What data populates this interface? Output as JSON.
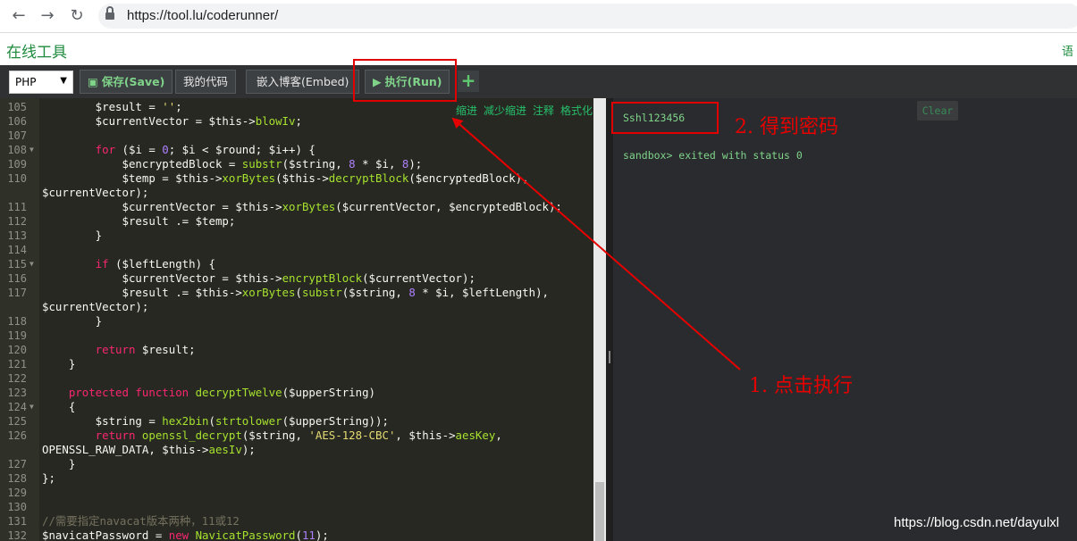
{
  "browser": {
    "back_icon": "arrow-left-icon",
    "forward_icon": "arrow-right-icon",
    "reload_icon": "reload-icon",
    "lock_icon": "lock-icon",
    "url": "https://tool.lu/coderunner/"
  },
  "site": {
    "title": "在线工具",
    "lang_link": "语"
  },
  "toolbar": {
    "language": "PHP",
    "save_label": "保存(Save)",
    "my_code_label": "我的代码",
    "embed_label": "嵌入博客(Embed)",
    "run_label": "执行(Run)",
    "add_label": "+"
  },
  "editor": {
    "links": [
      "缩进",
      "减少缩进",
      "注释",
      "格式化"
    ],
    "lines": [
      {
        "n": "105",
        "fold": false,
        "code": [
          [
            "var",
            "        $result = "
          ],
          [
            "str",
            "''"
          ],
          [
            "var",
            ";"
          ]
        ]
      },
      {
        "n": "106",
        "fold": false,
        "code": [
          [
            "var",
            "        $currentVector = $this->"
          ],
          [
            "fn",
            "blowIv"
          ],
          [
            "var",
            ";"
          ]
        ]
      },
      {
        "n": "107",
        "fold": false,
        "code": []
      },
      {
        "n": "108",
        "fold": true,
        "code": [
          [
            "kw",
            "        for"
          ],
          [
            "var",
            " ($i = "
          ],
          [
            "num",
            "0"
          ],
          [
            "var",
            "; $i < $round; $i++) {"
          ]
        ]
      },
      {
        "n": "109",
        "fold": false,
        "code": [
          [
            "var",
            "            $encryptedBlock = "
          ],
          [
            "fn",
            "substr"
          ],
          [
            "var",
            "($string, "
          ],
          [
            "num",
            "8"
          ],
          [
            "var",
            " * $i, "
          ],
          [
            "num",
            "8"
          ],
          [
            "var",
            ");"
          ]
        ]
      },
      {
        "n": "110",
        "fold": false,
        "code": [
          [
            "var",
            "            $temp = $this->"
          ],
          [
            "fn",
            "xorBytes"
          ],
          [
            "var",
            "($this->"
          ],
          [
            "fn",
            "decryptBlock"
          ],
          [
            "var",
            "($encryptedBlock),"
          ]
        ]
      },
      {
        "n": "",
        "fold": false,
        "code": [
          [
            "var",
            "$currentVector);"
          ]
        ]
      },
      {
        "n": "111",
        "fold": false,
        "code": [
          [
            "var",
            "            $currentVector = $this->"
          ],
          [
            "fn",
            "xorBytes"
          ],
          [
            "var",
            "($currentVector, $encryptedBlock);"
          ]
        ]
      },
      {
        "n": "112",
        "fold": false,
        "code": [
          [
            "var",
            "            $result .= $temp;"
          ]
        ]
      },
      {
        "n": "113",
        "fold": false,
        "code": [
          [
            "var",
            "        }"
          ]
        ]
      },
      {
        "n": "114",
        "fold": false,
        "code": []
      },
      {
        "n": "115",
        "fold": true,
        "code": [
          [
            "kw",
            "        if"
          ],
          [
            "var",
            " ($leftLength) {"
          ]
        ]
      },
      {
        "n": "116",
        "fold": false,
        "code": [
          [
            "var",
            "            $currentVector = $this->"
          ],
          [
            "fn",
            "encryptBlock"
          ],
          [
            "var",
            "($currentVector);"
          ]
        ]
      },
      {
        "n": "117",
        "fold": false,
        "code": [
          [
            "var",
            "            $result .= $this->"
          ],
          [
            "fn",
            "xorBytes"
          ],
          [
            "var",
            "("
          ],
          [
            "fn",
            "substr"
          ],
          [
            "var",
            "($string, "
          ],
          [
            "num",
            "8"
          ],
          [
            "var",
            " * $i, $leftLength),"
          ]
        ]
      },
      {
        "n": "",
        "fold": false,
        "code": [
          [
            "var",
            "$currentVector);"
          ]
        ]
      },
      {
        "n": "118",
        "fold": false,
        "code": [
          [
            "var",
            "        }"
          ]
        ]
      },
      {
        "n": "119",
        "fold": false,
        "code": []
      },
      {
        "n": "120",
        "fold": false,
        "code": [
          [
            "kw",
            "        return"
          ],
          [
            "var",
            " $result;"
          ]
        ]
      },
      {
        "n": "121",
        "fold": false,
        "code": [
          [
            "var",
            "    }"
          ]
        ]
      },
      {
        "n": "122",
        "fold": false,
        "code": []
      },
      {
        "n": "123",
        "fold": false,
        "code": [
          [
            "kw",
            "    protected function "
          ],
          [
            "fn",
            "decryptTwelve"
          ],
          [
            "var",
            "($upperString)"
          ]
        ]
      },
      {
        "n": "124",
        "fold": true,
        "code": [
          [
            "var",
            "    {"
          ]
        ]
      },
      {
        "n": "125",
        "fold": false,
        "code": [
          [
            "var",
            "        $string = "
          ],
          [
            "fn",
            "hex2bin"
          ],
          [
            "var",
            "("
          ],
          [
            "fn",
            "strtolower"
          ],
          [
            "var",
            "($upperString));"
          ]
        ]
      },
      {
        "n": "126",
        "fold": false,
        "code": [
          [
            "kw",
            "        return "
          ],
          [
            "fn",
            "openssl_decrypt"
          ],
          [
            "var",
            "($string, "
          ],
          [
            "str",
            "'AES-128-CBC'"
          ],
          [
            "var",
            ", $this->"
          ],
          [
            "fn",
            "aesKey"
          ],
          [
            "var",
            ","
          ]
        ]
      },
      {
        "n": "",
        "fold": false,
        "code": [
          [
            "var",
            "OPENSSL_RAW_DATA, $this->"
          ],
          [
            "fn",
            "aesIv"
          ],
          [
            "var",
            ");"
          ]
        ]
      },
      {
        "n": "127",
        "fold": false,
        "code": [
          [
            "var",
            "    }"
          ]
        ]
      },
      {
        "n": "128",
        "fold": false,
        "code": [
          [
            "var",
            "};"
          ]
        ]
      },
      {
        "n": "129",
        "fold": false,
        "code": []
      },
      {
        "n": "130",
        "fold": false,
        "code": []
      },
      {
        "n": "131",
        "fold": false,
        "code": [
          [
            "cm",
            "//需要指定navacat版本两种，11或12"
          ]
        ]
      },
      {
        "n": "132",
        "fold": false,
        "code": [
          [
            "var",
            "$navicatPassword = "
          ],
          [
            "kw",
            "new "
          ],
          [
            "fn",
            "NavicatPassword"
          ],
          [
            "var",
            "("
          ],
          [
            "num",
            "11"
          ],
          [
            "var",
            ");"
          ]
        ]
      }
    ]
  },
  "output": {
    "clear_label": "Clear",
    "result_line": "Sshl123456",
    "status_line": "sandbox> exited with status 0"
  },
  "annotations": {
    "step1": "1. 点击执行",
    "step2": "2. 得到密码",
    "color": "#e60000"
  },
  "watermark": "https://blog.csdn.net/dayulxl"
}
